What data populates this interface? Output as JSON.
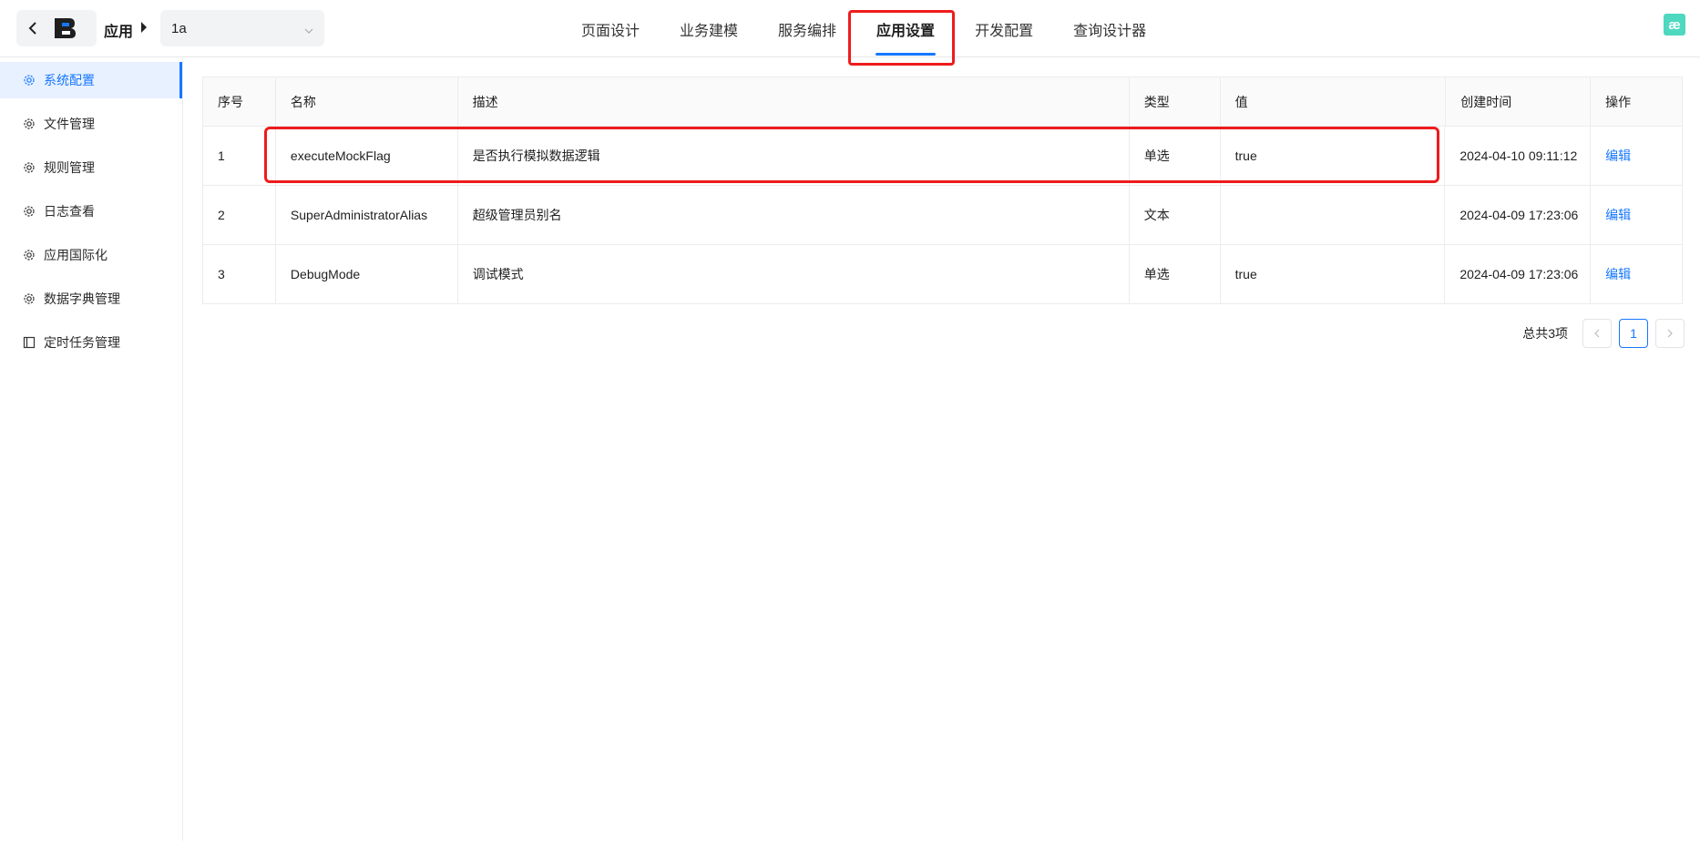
{
  "header": {
    "app_label": "应用",
    "app_select_value": "1a",
    "tabs": [
      {
        "label": "页面设计"
      },
      {
        "label": "业务建模"
      },
      {
        "label": "服务编排"
      },
      {
        "label": "应用设置"
      },
      {
        "label": "开发配置"
      },
      {
        "label": "查询设计器"
      }
    ],
    "active_tab": "应用设置",
    "corner_logo": "æ"
  },
  "sidebar": {
    "items": [
      {
        "label": "系统配置",
        "icon": "gear-icon"
      },
      {
        "label": "文件管理",
        "icon": "gear-icon"
      },
      {
        "label": "规则管理",
        "icon": "gear-icon"
      },
      {
        "label": "日志查看",
        "icon": "gear-icon"
      },
      {
        "label": "应用国际化",
        "icon": "gear-icon"
      },
      {
        "label": "数据字典管理",
        "icon": "gear-icon"
      },
      {
        "label": "定时任务管理",
        "icon": "layout-icon"
      }
    ],
    "active": "系统配置"
  },
  "table": {
    "headers": [
      "序号",
      "名称",
      "描述",
      "类型",
      "值",
      "创建时间",
      "操作"
    ],
    "rows": [
      {
        "idx": "1",
        "name": "executeMockFlag",
        "desc": "是否执行模拟数据逻辑",
        "type": "单选",
        "value": "true",
        "created": "2024-04-10 09:11:12",
        "action": "编辑"
      },
      {
        "idx": "2",
        "name": "SuperAdministratorAlias",
        "desc": "超级管理员别名",
        "type": "文本",
        "value": "",
        "created": "2024-04-09 17:23:06",
        "action": "编辑"
      },
      {
        "idx": "3",
        "name": "DebugMode",
        "desc": "调试模式",
        "type": "单选",
        "value": "true",
        "created": "2024-04-09 17:23:06",
        "action": "编辑"
      }
    ]
  },
  "pagination": {
    "total_text": "总共3项",
    "current_page": "1"
  },
  "colors": {
    "accent": "#1677ff",
    "highlight_box": "#ee1c1c"
  }
}
